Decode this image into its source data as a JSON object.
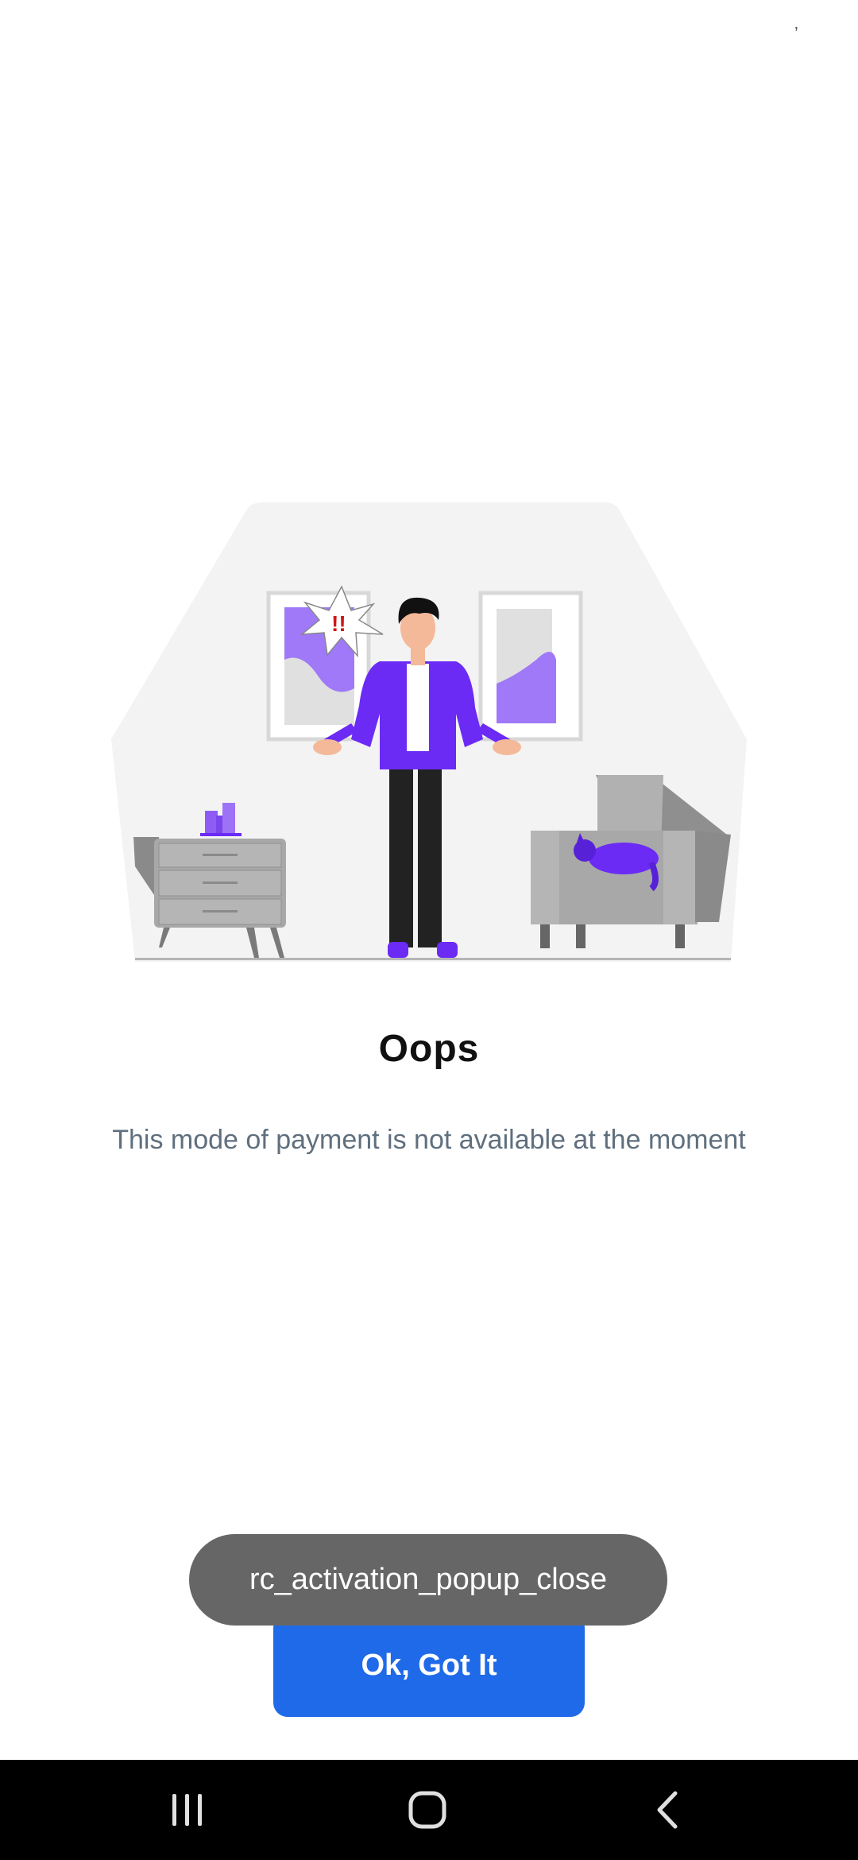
{
  "status": {
    "mark": "ʼ"
  },
  "dialog": {
    "title": "Oops",
    "message": "This mode of payment is not available at the moment",
    "button_label": "Ok, Got It"
  },
  "toast": {
    "text": "rc_activation_popup_close"
  },
  "nav": {
    "recents_icon": "recents-icon",
    "home_icon": "home-icon",
    "back_icon": "back-icon"
  },
  "colors": {
    "accent_blue": "#1f6ae8",
    "purple": "#6b2bf5",
    "toast_bg": "#666666"
  }
}
